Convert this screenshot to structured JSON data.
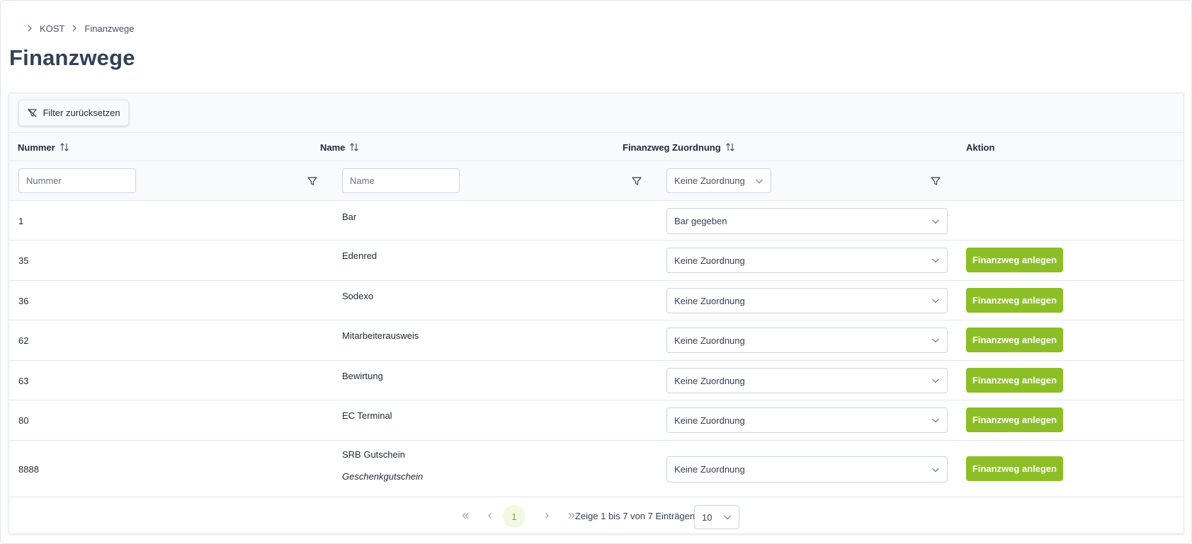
{
  "breadcrumb": {
    "items": [
      "KOST",
      "Finanzwege"
    ]
  },
  "page": {
    "title": "Finanzwege"
  },
  "toolbar": {
    "filter_reset_label": "Filter zurücksetzen"
  },
  "table": {
    "columns": {
      "number": "Nummer",
      "name": "Name",
      "assignment": "Finanzweg Zuordnung",
      "action": "Aktion"
    },
    "filters": {
      "number_placeholder": "Nummer",
      "name_placeholder": "Name",
      "assignment_value": "Keine Zuordnung"
    },
    "rows": [
      {
        "number": "1",
        "name": "Bar",
        "subtitle": "",
        "assignment": "Bar gegeben",
        "action": ""
      },
      {
        "number": "35",
        "name": "Edenred",
        "subtitle": "",
        "assignment": "Keine Zuordnung",
        "action": "Finanzweg anlegen"
      },
      {
        "number": "36",
        "name": "Sodexo",
        "subtitle": "",
        "assignment": "Keine Zuordnung",
        "action": "Finanzweg anlegen"
      },
      {
        "number": "62",
        "name": "Mitarbeiterausweis",
        "subtitle": "",
        "assignment": "Keine Zuordnung",
        "action": "Finanzweg anlegen"
      },
      {
        "number": "63",
        "name": "Bewirtung",
        "subtitle": "",
        "assignment": "Keine Zuordnung",
        "action": "Finanzweg anlegen"
      },
      {
        "number": "80",
        "name": "EC Terminal",
        "subtitle": "",
        "assignment": "Keine Zuordnung",
        "action": "Finanzweg anlegen"
      },
      {
        "number": "8888",
        "name": "SRB Gutschein",
        "subtitle": "Geschenkgutschein",
        "assignment": "Keine Zuordnung",
        "action": "Finanzweg anlegen"
      }
    ]
  },
  "pagination": {
    "current_page": "1",
    "info": "Zeige 1 bis 7 von 7 Einträgen",
    "page_size": "10"
  },
  "colors": {
    "accent_green": "#8cbf26",
    "text_dark": "#334155",
    "border": "#e2e8f0"
  }
}
